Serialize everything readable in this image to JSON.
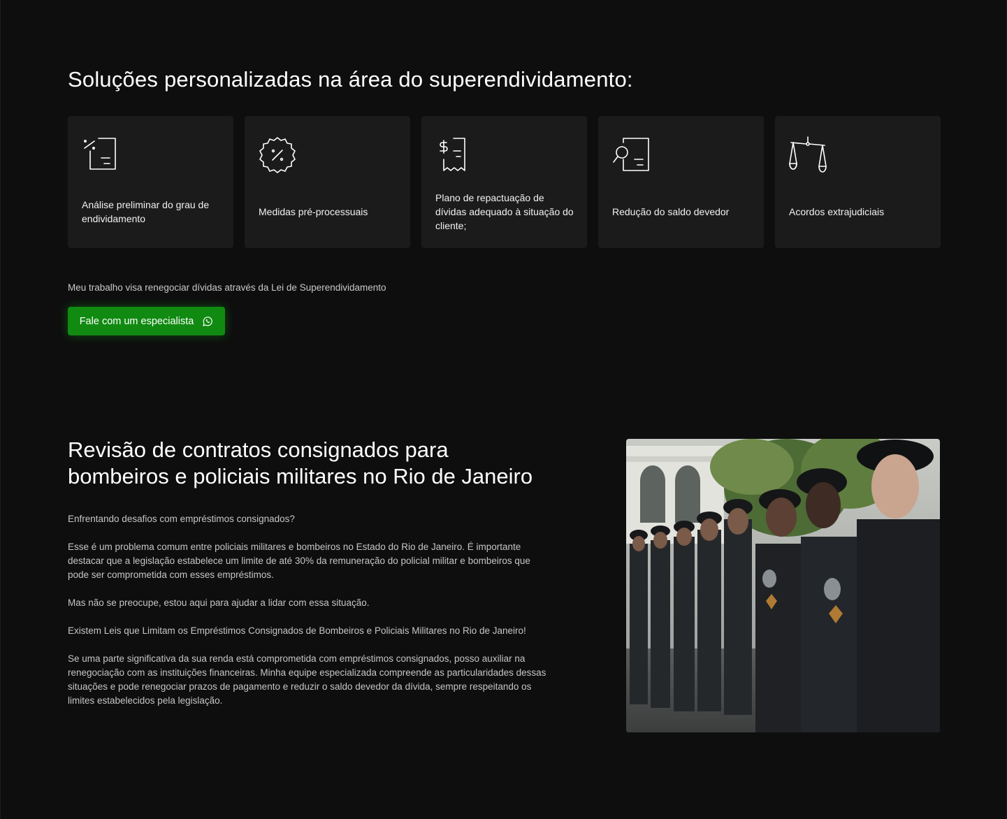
{
  "solutions": {
    "title": "Soluções personalizadas na área do superendividamento:",
    "cards": [
      {
        "icon": "percent-document-icon",
        "label": "Análise preliminar do grau de endividamento"
      },
      {
        "icon": "discount-badge-icon",
        "label": "Medidas pré-processuais"
      },
      {
        "icon": "dollar-receipt-icon",
        "label": "Plano de repactuação de dívidas adequado à situação do cliente;"
      },
      {
        "icon": "search-document-icon",
        "label": "Redução do saldo devedor"
      },
      {
        "icon": "scales-icon",
        "label": "Acordos extrajudiciais"
      }
    ],
    "intro": "Meu trabalho visa renegociar dívidas através da Lei de Superendividamento",
    "cta_label": "Fale com um especialista",
    "cta_icon": "whatsapp-icon",
    "cta_color": "#118a12"
  },
  "consignados": {
    "title_line1": "Revisão de contratos consignados para",
    "title_line2": "bombeiros e policiais militares no Rio de Janeiro",
    "paragraphs": [
      "Enfrentando desafios com empréstimos consignados?",
      "Esse é um problema comum entre policiais militares e bombeiros no Estado do Rio de Janeiro. É importante destacar que a legislação estabelece um limite de até 30% da remuneração do policial militar e bombeiros que pode ser comprometida com esses empréstimos.",
      "Mas não se preocupe, estou aqui para ajudar a lidar com essa situação.",
      "Existem Leis que Limitam os Empréstimos Consignados de Bombeiros e Policiais Militares no Rio de Janeiro!",
      "Se uma parte significativa da sua renda está comprometida com empréstimos consignados, posso auxiliar na renegociação com as instituições financeiras. Minha equipe especializada compreende as particularidades dessas situações e pode renegociar prazos de pagamento e reduzir o saldo devedor da dívida, sempre respeitando os limites estabelecidos pela legislação."
    ]
  }
}
